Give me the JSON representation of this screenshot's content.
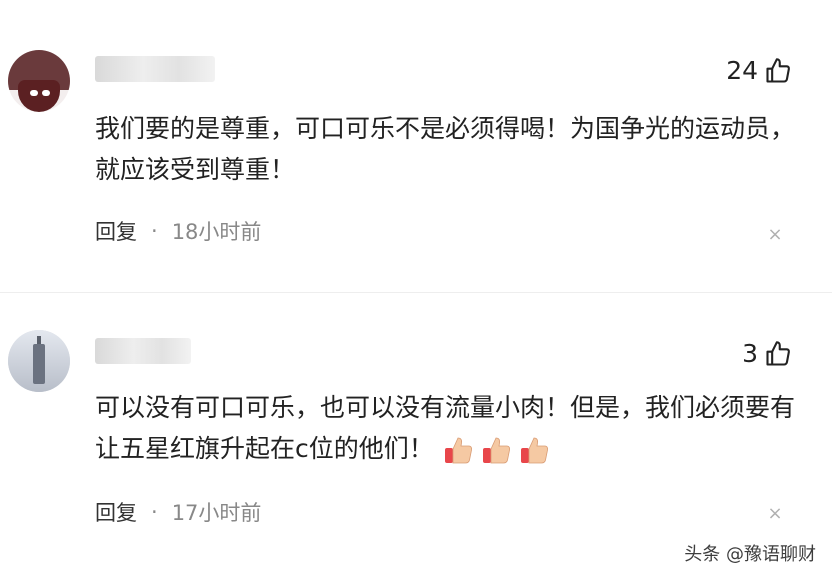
{
  "comments": [
    {
      "likes": "24",
      "text": "我们要的是尊重，可口可乐不是必须得喝！为国争光的运动员，就应该受到尊重！",
      "reply_label": "回复",
      "separator": "·",
      "time": "18小时前",
      "close": "×"
    },
    {
      "likes": "3",
      "text": "可以没有可口可乐，也可以没有流量小肉！但是，我们必须要有让五星红旗升起在c位的他们！",
      "emojis": [
        "thumbs-up-icon",
        "thumbs-up-icon",
        "thumbs-up-icon"
      ],
      "reply_label": "回复",
      "separator": "·",
      "time": "17小时前",
      "close": "×"
    }
  ],
  "watermark": "头条 @豫语聊财",
  "colors": {
    "text": "#222222",
    "meta": "#888888",
    "emoji": "#f5c9a3"
  }
}
